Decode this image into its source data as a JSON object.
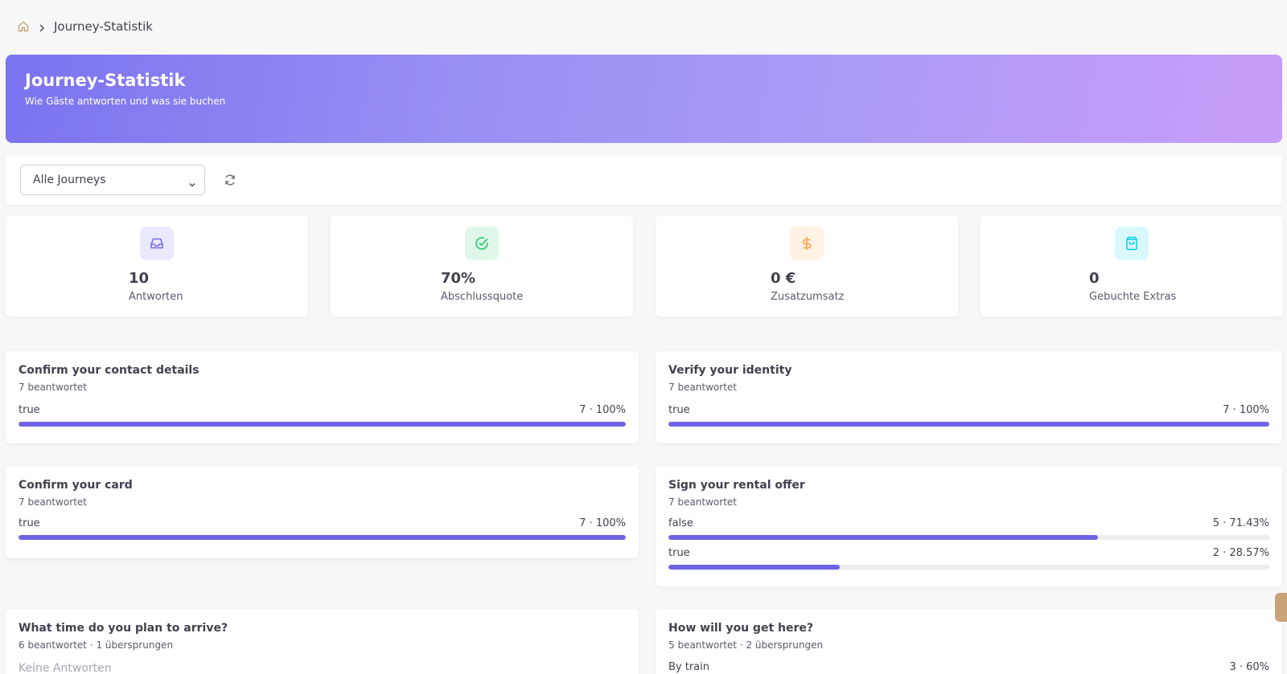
{
  "breadcrumb": {
    "current": "Journey-Statistik"
  },
  "hero": {
    "title": "Journey-Statistik",
    "subtitle": "Wie Gäste antworten und was sie buchen"
  },
  "filter": {
    "selected": "Alle Journeys"
  },
  "stats": [
    {
      "value": "10",
      "label": "Antworten",
      "icon": "inbox-icon",
      "color": "#7367f0"
    },
    {
      "value": "70%",
      "label": "Abschlussquote",
      "icon": "check-circle-icon",
      "color": "#28c76f"
    },
    {
      "value": "0 €",
      "label": "Zusatzumsatz",
      "icon": "dollar-icon",
      "color": "#ff9f43"
    },
    {
      "value": "0",
      "label": "Gebuchte Extras",
      "icon": "shopping-bag-icon",
      "color": "#00cfe8"
    }
  ],
  "questions": [
    {
      "title": "Confirm your contact details",
      "sub": "7 beantwortet",
      "options": [
        {
          "label": "true",
          "value": "7 · 100%",
          "fraction": 1.0
        }
      ]
    },
    {
      "title": "Verify your identity",
      "sub": "7 beantwortet",
      "options": [
        {
          "label": "true",
          "value": "7 · 100%",
          "fraction": 1.0
        }
      ]
    },
    {
      "title": "Confirm your card",
      "sub": "7 beantwortet",
      "options": [
        {
          "label": "true",
          "value": "7 · 100%",
          "fraction": 1.0
        }
      ]
    },
    {
      "title": "Sign your rental offer",
      "sub": "7 beantwortet",
      "options": [
        {
          "label": "false",
          "value": "5 · 71.43%",
          "fraction": 0.7143
        },
        {
          "label": "true",
          "value": "2 · 28.57%",
          "fraction": 0.2857
        }
      ]
    },
    {
      "title": "What time do you plan to arrive?",
      "sub": "6 beantwortet · 1 übersprungen",
      "empty": "Keine Antworten"
    },
    {
      "title": "How will you get here?",
      "sub": "5 beantwortet · 2 übersprungen",
      "options": [
        {
          "label": "By train",
          "value": "3 · 60%",
          "fraction": 0.6
        }
      ]
    }
  ],
  "colors": {
    "accent": "#6f62e4",
    "track": "#ededf0"
  }
}
